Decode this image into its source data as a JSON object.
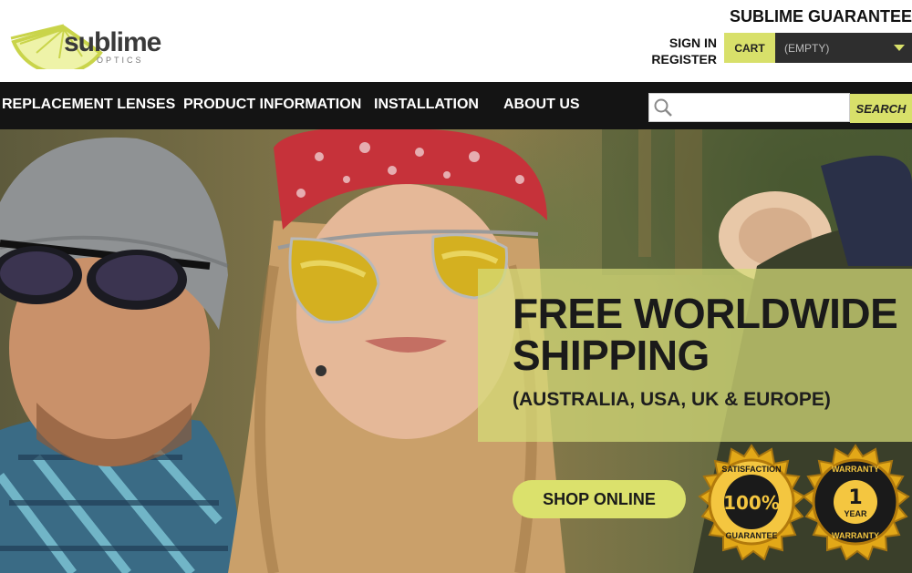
{
  "logo": {
    "word": "sublime",
    "sub": "OPTICS"
  },
  "header": {
    "guarantee": "SUBLIME GUARANTEE",
    "sign_in": "SIGN IN",
    "register": "REGISTER",
    "cart_label": "CART",
    "cart_status": "(EMPTY)"
  },
  "nav": {
    "items": [
      "REPLACEMENT LENSES",
      "PRODUCT INFORMATION",
      "INSTALLATION",
      "ABOUT US"
    ]
  },
  "search": {
    "placeholder": "",
    "value": "",
    "button": "SEARCH"
  },
  "hero": {
    "title_line1": "FREE WORLDWIDE",
    "title_line2": "SHIPPING",
    "subtitle": "(AUSTRALIA, USA, UK & EUROPE)",
    "cta": "SHOP ONLINE"
  },
  "badges": [
    {
      "top": "SATISFACTION",
      "center": "100%",
      "bottom": "GUARANTEE"
    },
    {
      "top": "WARRANTY",
      "center": "1",
      "center_sub": "YEAR",
      "bottom": "WARRANTY"
    }
  ],
  "colors": {
    "accent": "#d8e06a",
    "nav_bg": "#141414",
    "cart_bg": "#2e2e2e",
    "gold": "#e0a81c"
  }
}
